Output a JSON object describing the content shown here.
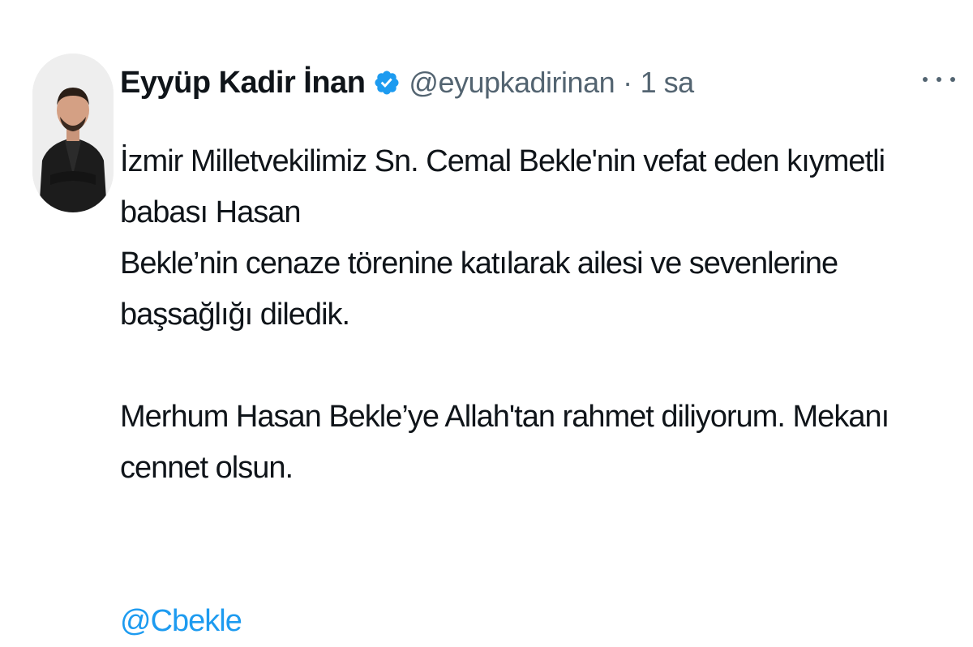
{
  "author": {
    "display_name": "Eyyüp Kadir İnan",
    "handle": "@eyupkadirinan",
    "separator": "·",
    "time": "1 sa",
    "verified": true
  },
  "icons": {
    "verified": "verified-badge-icon",
    "more": "more-options-icon"
  },
  "colors": {
    "text": "#0f1419",
    "secondary": "#536471",
    "accent": "#1d9bf0"
  },
  "tweet": {
    "paragraph1_line1": "İzmir Milletvekilimiz Sn. Cemal Bekle'nin vefat eden kıymetli babası Hasan",
    "paragraph1_line2": "Bekle’nin cenaze törenine katılarak ailesi ve sevenlerine başsağlığı diledik.",
    "paragraph2": "Merhum Hasan Bekle’ye Allah'tan rahmet diliyorum. Mekanı cennet olsun.",
    "mention": "@Cbekle"
  }
}
